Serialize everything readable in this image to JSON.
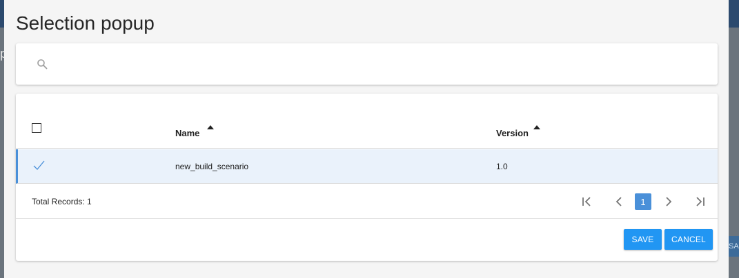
{
  "modal": {
    "title": "Selection popup"
  },
  "search": {
    "value": "",
    "placeholder": "",
    "icon": "search-icon"
  },
  "table": {
    "columns": [
      {
        "label": "Name",
        "sort": "ascending"
      },
      {
        "label": "Version",
        "sort": "ascending"
      }
    ],
    "rows": [
      {
        "selected": true,
        "name": "new_build_scenario",
        "version": "1.0"
      }
    ]
  },
  "footer": {
    "total_records": "Total Records: 1"
  },
  "pagination": {
    "current_page": "1"
  },
  "actions": {
    "save_label": "SAVE",
    "cancel_label": "CANCEL"
  },
  "background": {
    "left_char": "p",
    "right_button_text": "SA"
  },
  "colors": {
    "accent": "#2196f3",
    "row_selected": "#eaf2fb",
    "page_active": "#4a90d9"
  }
}
